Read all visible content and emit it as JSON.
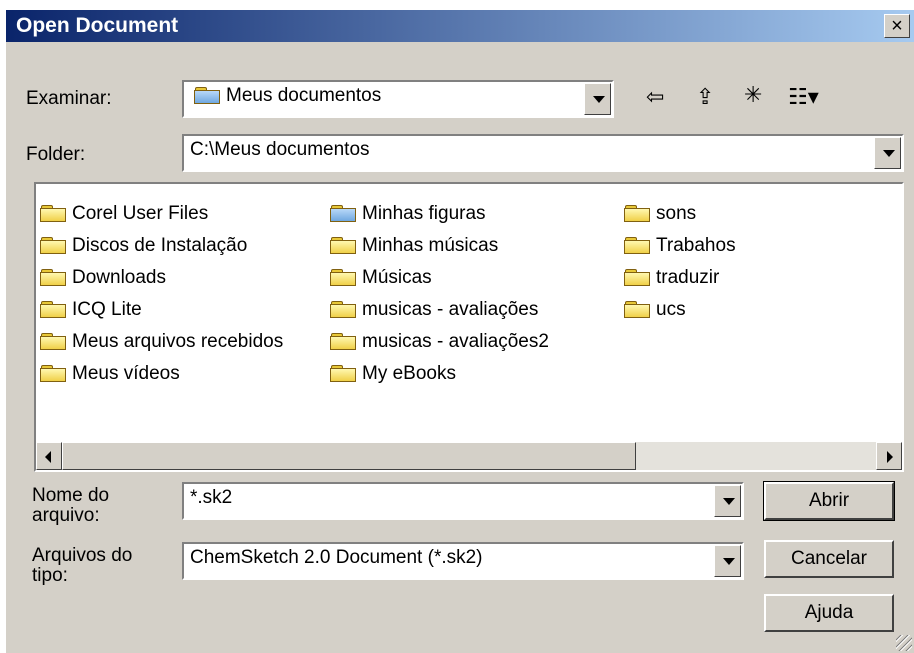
{
  "window": {
    "title": "Open Document",
    "close_label": "×"
  },
  "lookin": {
    "label": "Examinar:",
    "value": "Meus documentos"
  },
  "toolbar": {
    "back_icon": "back-arrow-icon",
    "up_icon": "up-folder-icon",
    "new_icon": "new-folder-icon",
    "view_icon": "view-menu-icon"
  },
  "folder_field": {
    "label": "Folder:",
    "value": "C:\\Meus documentos"
  },
  "file_list": {
    "col1": [
      "Corel User Files",
      "Discos de Instalação",
      "Downloads",
      "ICQ Lite",
      "Meus arquivos recebidos",
      "Meus vídeos"
    ],
    "col2": [
      "Minhas figuras",
      "Minhas músicas",
      "Músicas",
      "musicas - avaliações",
      "musicas - avaliações2",
      "My eBooks"
    ],
    "col3": [
      "sons",
      "Trabahos",
      "traduzir",
      "ucs"
    ]
  },
  "filename": {
    "label_line1": "Nome do",
    "label_line2": "arquivo:",
    "value": "*.sk2"
  },
  "filetype": {
    "label_line1": "Arquivos do",
    "label_line2": "tipo:",
    "value": "ChemSketch 2.0 Document (*.sk2)"
  },
  "buttons": {
    "open": "Abrir",
    "cancel": "Cancelar",
    "help": "Ajuda"
  }
}
